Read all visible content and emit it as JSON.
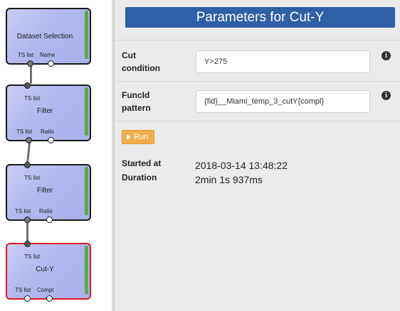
{
  "workflow": {
    "nodes": [
      {
        "title": "Dataset Selection",
        "outputs": [
          "TS list",
          "Name"
        ]
      },
      {
        "title": "Filter",
        "input": "TS list",
        "outputs": [
          "TS list",
          "Ratio"
        ]
      },
      {
        "title": "Filter",
        "input": "TS list",
        "outputs": [
          "TS list",
          "Ratio"
        ]
      },
      {
        "title": "Cut-Y",
        "input": "TS list",
        "outputs": [
          "TS list",
          "Compl"
        ],
        "selected": true
      }
    ]
  },
  "panel": {
    "title": "Parameters for Cut-Y",
    "fields": [
      {
        "label_line1": "Cut",
        "label_line2": "condition",
        "value": "Y>275"
      },
      {
        "label_line1": "FuncId",
        "label_line2": "pattern",
        "value": "{fid}__Miami_temp_3_cutY{compl}"
      }
    ],
    "run_label": "Run",
    "info": [
      {
        "label": "Started at",
        "value": "2018-03-14 13:48:22"
      },
      {
        "label": "Duration",
        "value": "2min 1s 937ms"
      }
    ]
  },
  "colors": {
    "title_bar": "#2f5fa7",
    "run_button": "#f0ad4e",
    "selected_border": "#e0191f",
    "status_bar": "#5aa94a"
  }
}
